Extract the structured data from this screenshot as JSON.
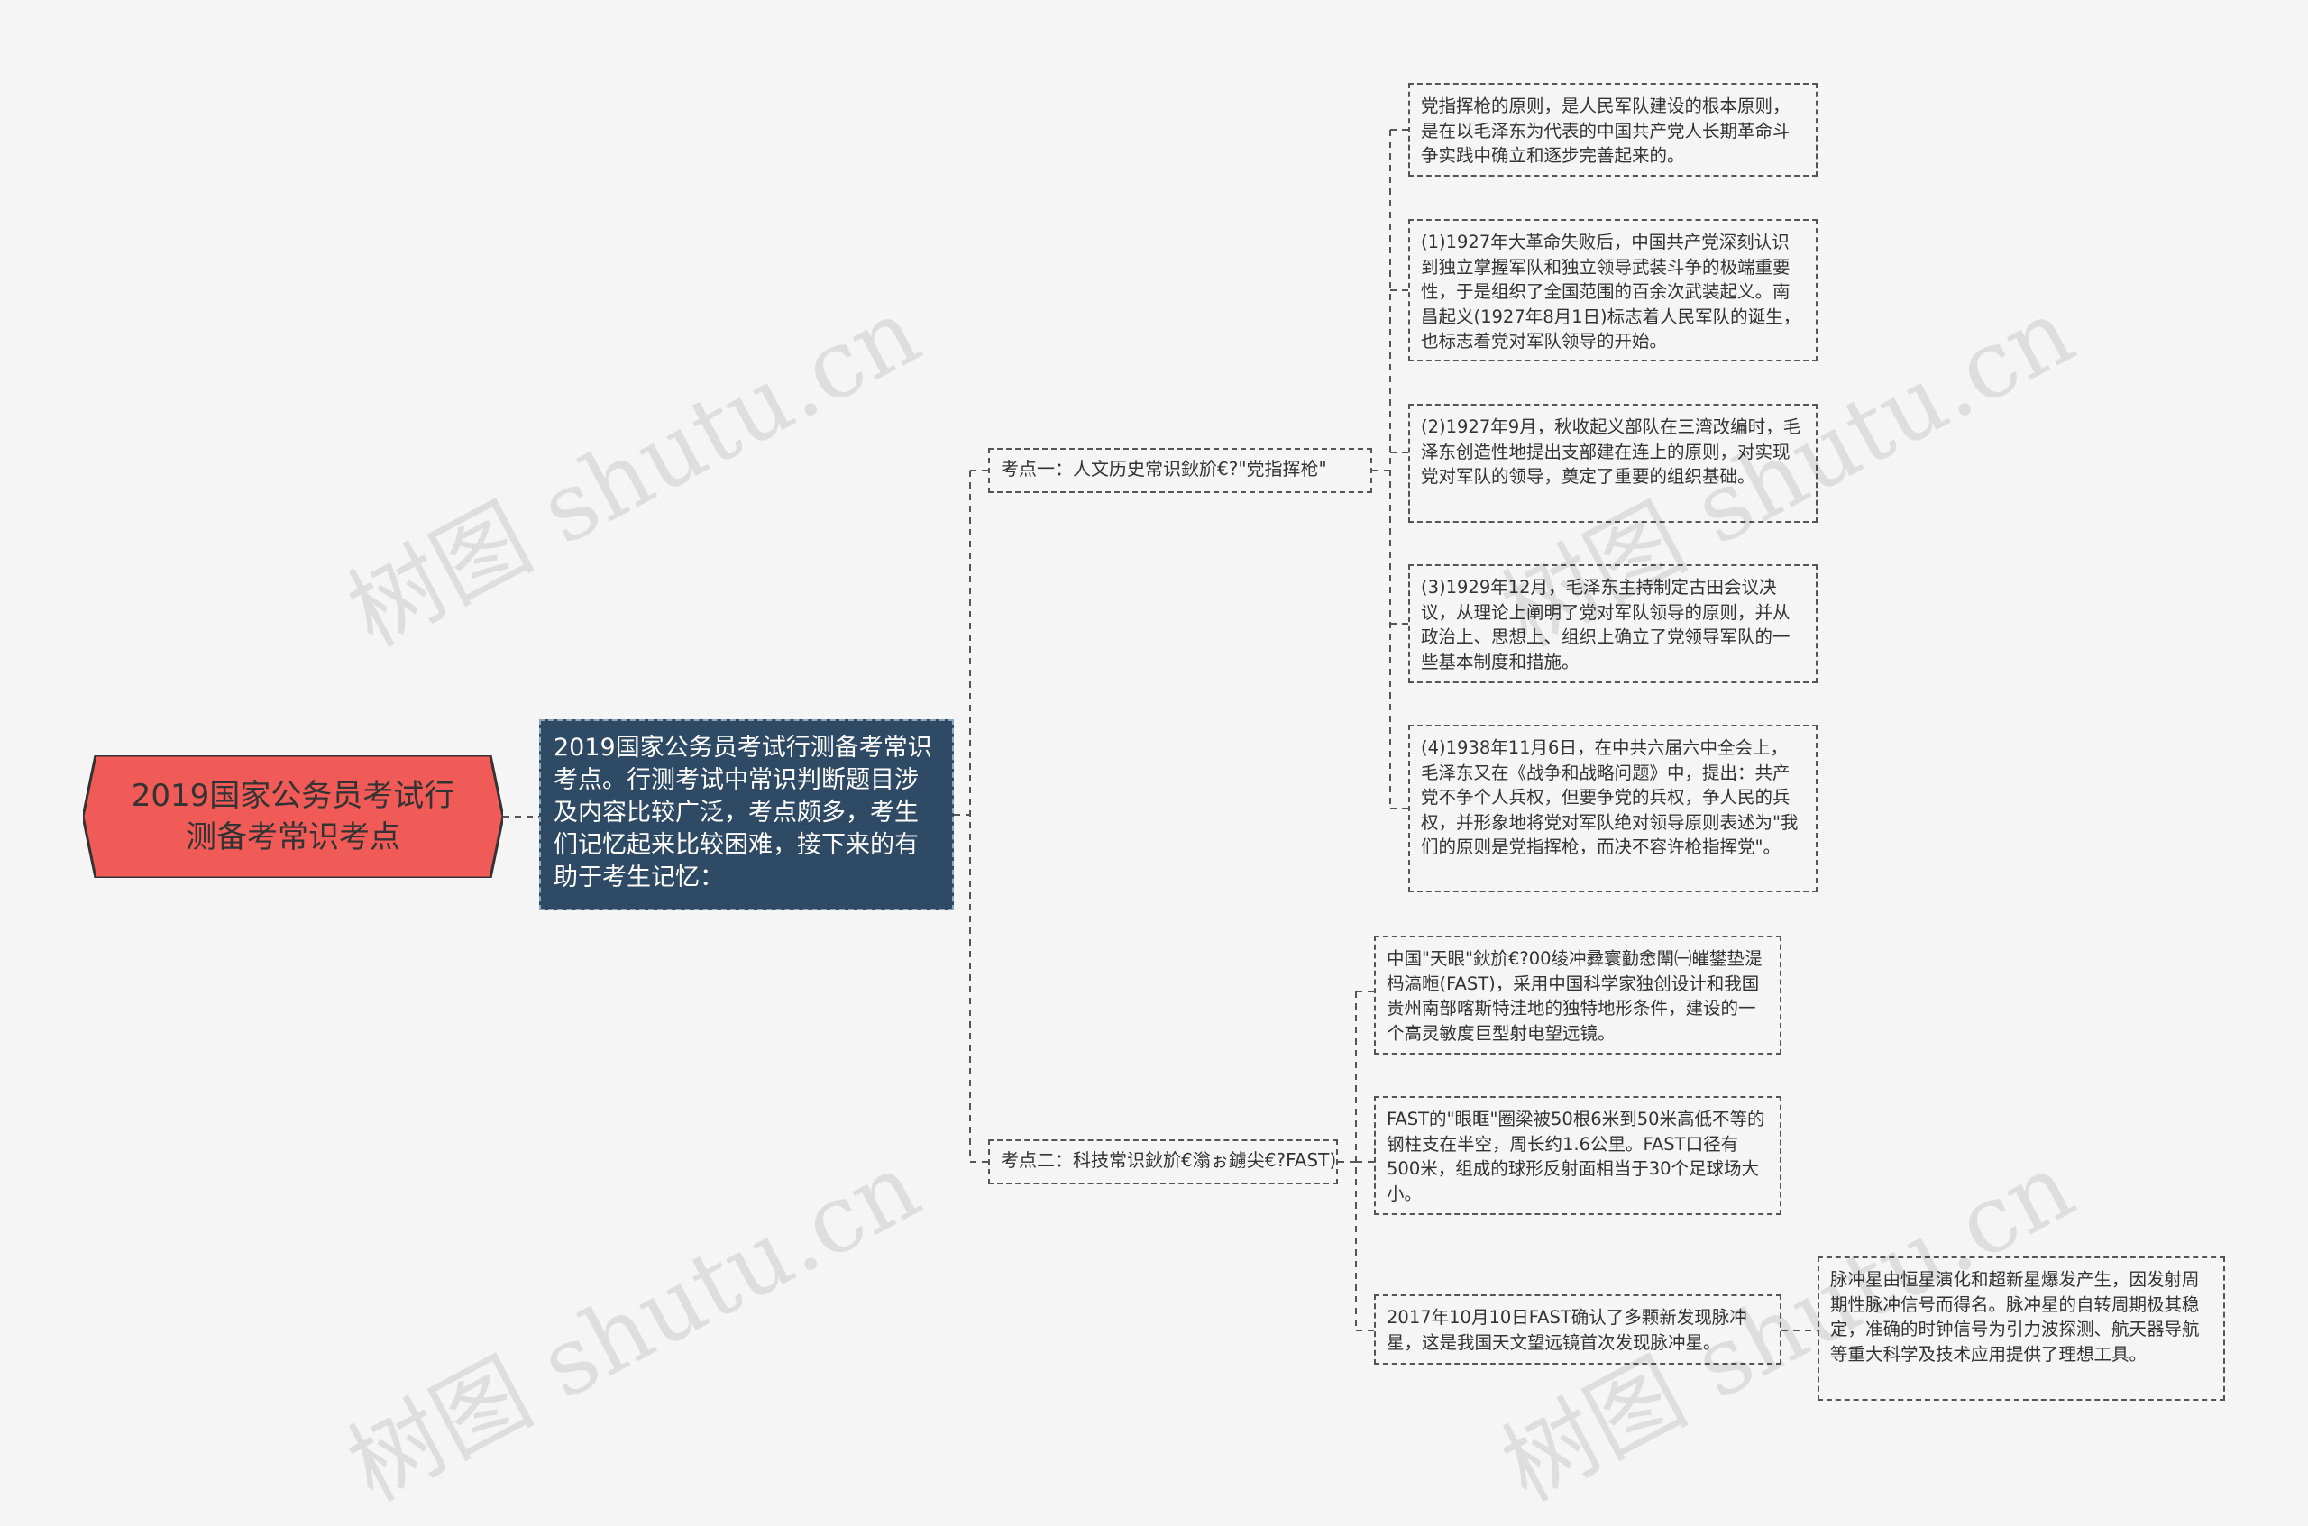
{
  "root": {
    "title": "2019国家公务员考试行测备考常识考点",
    "color": "#f05a57"
  },
  "center": {
    "text": "2019国家公务员考试行测备考常识考点。行测考试中常识判断题目涉及内容比较广泛，考点颇多，考生们记忆起来比较困难，接下来的有助于考生记忆：",
    "color": "#2e4a64"
  },
  "branch1": {
    "label": "考点一：人文历史常识鈥斺€?\"党指挥枪\"",
    "leaves": [
      "党指挥枪的原则，是人民军队建设的根本原则，是在以毛泽东为代表的中国共产党人长期革命斗争实践中确立和逐步完善起来的。",
      "(1)1927年大革命失败后，中国共产党深刻认识到独立掌握军队和独立领导武装斗争的极端重要性，于是组织了全国范围的百余次武装起义。南昌起义(1927年8月1日)标志着人民军队的诞生，也标志着党对军队领导的开始。",
      "(2)1927年9月，秋收起义部队在三湾改编时，毛泽东创造性地提出支部建在连上的原则，对实现党对军队的领导，奠定了重要的组织基础。",
      "(3)1929年12月，毛泽东主持制定古田会议决议，从理论上阐明了党对军队领导的原则，并从政治上、思想上、组织上确立了党领导军队的一些基本制度和措施。",
      "(4)1938年11月6日，在中共六届六中全会上，毛泽东又在《战争和战略问题》中，提出：共产党不争个人兵权，但要争党的兵权，争人民的兵权，并形象地将党对军队绝对领导原则表述为\"我们的原则是党指挥枪，而决不容许枪指挥党\"。"
    ]
  },
  "branch2": {
    "label": "考点二：科技常识鈥斺€滃ぉ鐪尖€?FAST)",
    "leaves": [
      "中国\"天眼\"鈥斺€?00绫冲彛寰勭悆闈㈠皠鐢垫湜杩滈暅(FAST)，采用中国科学家独创设计和我国贵州南部喀斯特洼地的独特地形条件，建设的一个高灵敏度巨型射电望远镜。",
      "FAST的\"眼眶\"圈梁被50根6米到50米高低不等的钢柱支在半空，周长约1.6公里。FAST口径有500米，组成的球形反射面相当于30个足球场大小。",
      "2017年10月10日FAST确认了多颗新发现脉冲星，这是我国天文望远镜首次发现脉冲星。"
    ],
    "sub_leaf": "脉冲星由恒星演化和超新星爆发产生，因发射周期性脉冲信号而得名。脉冲星的自转周期极其稳定，准确的时钟信号为引力波探测、航天器导航等重大科学及技术应用提供了理想工具。"
  },
  "watermark": "树图 shutu.cn"
}
